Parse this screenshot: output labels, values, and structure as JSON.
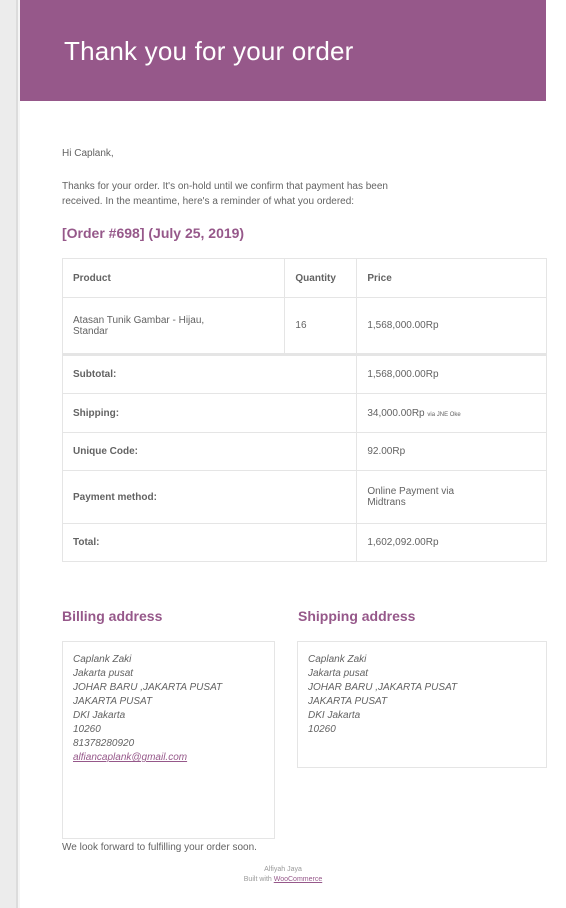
{
  "header": {
    "title": "Thank you for your order"
  },
  "greeting": "Hi Caplank,",
  "intro_line1": "Thanks for your order. It's on-hold until we confirm that payment has been",
  "intro_line2": "received. In the meantime, here's a reminder of what you ordered:",
  "order_heading": "[Order #698] (July 25, 2019)",
  "table": {
    "headers": {
      "product": "Product",
      "quantity": "Quantity",
      "price": "Price"
    },
    "item": {
      "name_line1": "Atasan Tunik Gambar - Hijau,",
      "name_line2": "Standar",
      "quantity": "16",
      "price": "1,568,000.00Rp"
    },
    "totals": {
      "subtotal_label": "Subtotal:",
      "subtotal_value": "1,568,000.00Rp",
      "shipping_label": "Shipping:",
      "shipping_value": "34,000.00Rp",
      "shipping_via": "via JNE Oke",
      "unique_code_label": "Unique Code:",
      "unique_code_value": "92.00Rp",
      "payment_label": "Payment method:",
      "payment_value_line1": "Online Payment via",
      "payment_value_line2": "Midtrans",
      "total_label": "Total:",
      "total_value": "1,602,092.00Rp"
    }
  },
  "billing": {
    "title": "Billing address",
    "lines": [
      "Caplank Zaki",
      "Jakarta pusat",
      "JOHAR BARU ,JAKARTA PUSAT",
      "JAKARTA PUSAT",
      "DKI Jakarta",
      "10260",
      "81378280920"
    ],
    "email": "alfiancaplank@gmail.com"
  },
  "shipping": {
    "title": "Shipping address",
    "lines": [
      "Caplank Zaki",
      "Jakarta pusat",
      "JOHAR BARU ,JAKARTA PUSAT",
      "JAKARTA PUSAT",
      "DKI Jakarta",
      "10260"
    ]
  },
  "closing": "We look forward to fulfilling your order soon.",
  "footer": {
    "site_name": "Alfiyah Jaya",
    "built_with": "Built with",
    "link_text": "WooCommerce"
  },
  "colors": {
    "brand": "#96588a",
    "text": "#636363",
    "border": "#e5e5e5"
  }
}
